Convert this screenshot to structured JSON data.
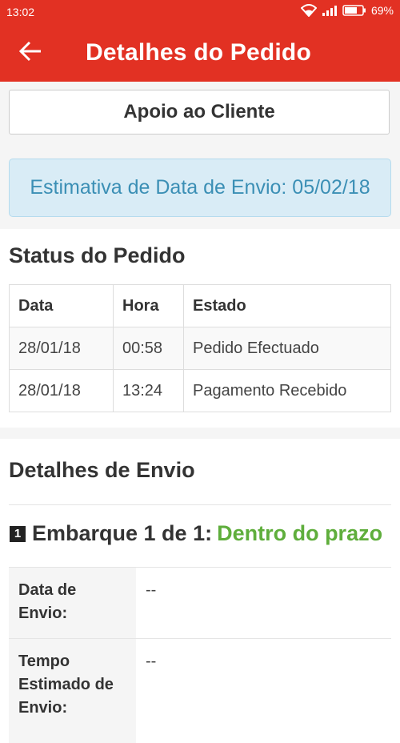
{
  "status_bar": {
    "time": "13:02",
    "battery": "69%",
    "icons": [
      "wifi-icon",
      "signal-icon",
      "battery-icon"
    ]
  },
  "app_bar": {
    "back_icon": "arrow-left-icon",
    "title": "Detalhes do Pedido"
  },
  "support": {
    "button_label": "Apoio ao Cliente"
  },
  "estimate": {
    "text": "Estimativa de Data de Envio: 05/02/18"
  },
  "order_status": {
    "title": "Status do Pedido",
    "columns": [
      "Data",
      "Hora",
      "Estado"
    ],
    "rows": [
      [
        "28/01/18",
        "00:58",
        "Pedido Efectuado"
      ],
      [
        "28/01/18",
        "13:24",
        "Pagamento Recebido"
      ]
    ]
  },
  "shipping": {
    "title": "Detalhes de Envio",
    "shipment_number": "1",
    "shipment_label": "Embarque 1 de 1:",
    "shipment_status": "Dentro do prazo",
    "details": [
      {
        "label": "Data de Envio:",
        "value": "--"
      },
      {
        "label": "Tempo Estimado de Envio:",
        "value": "--"
      }
    ]
  },
  "colors": {
    "primary_red": "#e23123",
    "info_text": "#3b8fb5",
    "info_background": "#d9ecf6",
    "on_time_green": "#5fae3c"
  }
}
